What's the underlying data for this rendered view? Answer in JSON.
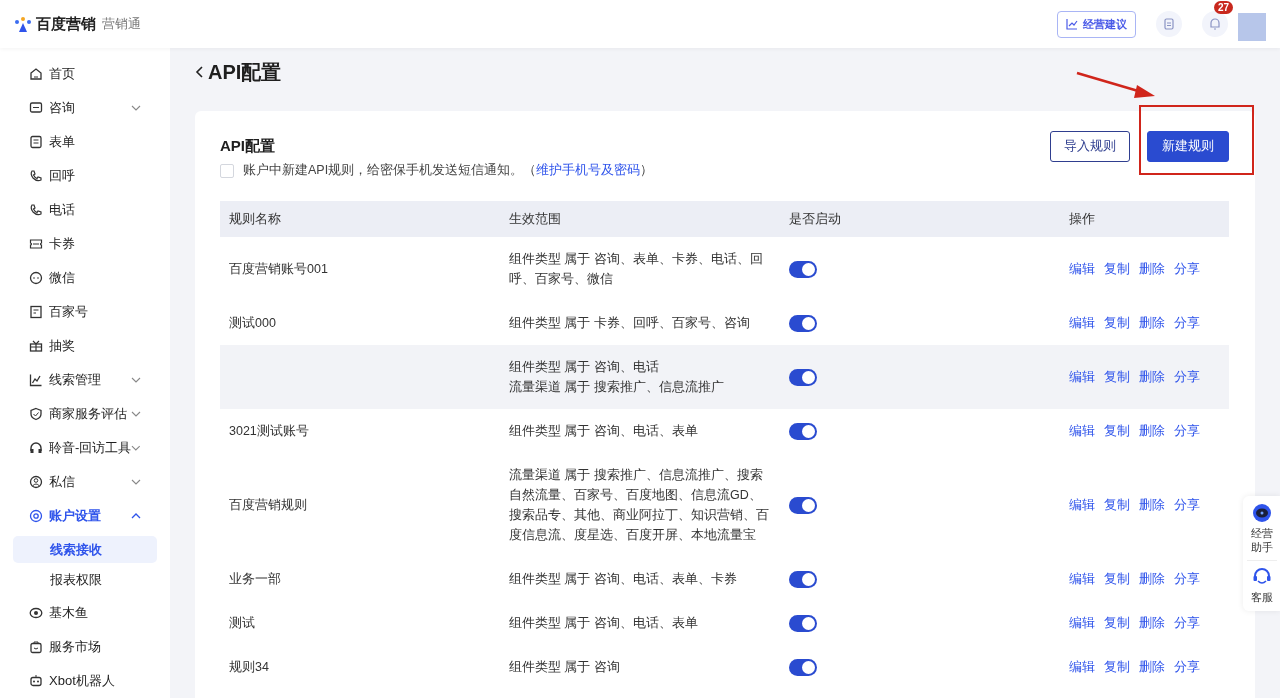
{
  "header": {
    "logo_text": "百度营销",
    "product": "营销通",
    "advice_button": "经营建议",
    "notification_count": "27"
  },
  "sidebar": {
    "items": [
      {
        "label": "首页",
        "selected": false
      },
      {
        "label": "咨询",
        "expanded": false,
        "selected": false
      },
      {
        "label": "表单",
        "selected": false
      },
      {
        "label": "回呼",
        "selected": false
      },
      {
        "label": "电话",
        "selected": false
      },
      {
        "label": "卡券",
        "selected": false
      },
      {
        "label": "微信",
        "selected": false
      },
      {
        "label": "百家号",
        "selected": false
      },
      {
        "label": "抽奖",
        "selected": false
      },
      {
        "label": "线索管理",
        "expanded": false,
        "selected": false
      },
      {
        "label": "商家服务评估",
        "expanded": false,
        "selected": false
      },
      {
        "label": "聆音-回访工具",
        "expanded": false,
        "selected": false
      },
      {
        "label": "私信",
        "expanded": false,
        "selected": false
      },
      {
        "label": "账户设置",
        "expanded": true,
        "selected": true,
        "children": [
          {
            "label": "线索接收",
            "selected": true
          },
          {
            "label": "报表权限",
            "selected": false
          }
        ]
      },
      {
        "label": "基木鱼",
        "selected": false
      },
      {
        "label": "服务市场",
        "selected": false
      },
      {
        "label": "Xbot机器人",
        "selected": false
      }
    ]
  },
  "page_title": "API配置",
  "card": {
    "title": "API配置",
    "import_button": "导入规则",
    "new_button": "新建规则",
    "notify": {
      "checked": false,
      "text": "账户中新建API规则，给密保手机发送短信通知。（",
      "link": "维护手机号及密码",
      "suffix": "）"
    },
    "table": {
      "columns": [
        "规则名称",
        "生效范围",
        "是否启动",
        "操作"
      ],
      "rows": [
        {
          "name": "百度营销账号001",
          "scope": [
            "组件类型 属于 咨询、表单、卡券、电话、回呼、百家号、微信"
          ],
          "on": true,
          "hovered": false,
          "actions": [
            "编辑",
            "复制",
            "删除",
            "分享"
          ]
        },
        {
          "name": "测试000",
          "scope": [
            "组件类型 属于 卡券、回呼、百家号、咨询"
          ],
          "on": true,
          "hovered": false,
          "actions": [
            "编辑",
            "复制",
            "删除",
            "分享"
          ]
        },
        {
          "name": "",
          "scope": [
            "组件类型 属于 咨询、电话",
            "流量渠道 属于 搜索推广、信息流推广"
          ],
          "on": true,
          "hovered": true,
          "actions": [
            "编辑",
            "复制",
            "删除",
            "分享"
          ]
        },
        {
          "name": "3021测试账号",
          "scope": [
            "组件类型 属于 咨询、电话、表单"
          ],
          "on": true,
          "hovered": false,
          "actions": [
            "编辑",
            "复制",
            "删除",
            "分享"
          ]
        },
        {
          "name": "百度营销规则",
          "scope": [
            "流量渠道 属于 搜索推广、信息流推广、搜索自然流量、百家号、百度地图、信息流GD、搜索品专、其他、商业阿拉丁、知识营销、百度信息流、度星选、百度开屏、本地流量宝"
          ],
          "on": true,
          "hovered": false,
          "actions": [
            "编辑",
            "复制",
            "删除",
            "分享"
          ]
        },
        {
          "name": "业务一部",
          "scope": [
            "组件类型 属于 咨询、电话、表单、卡券"
          ],
          "on": true,
          "hovered": false,
          "actions": [
            "编辑",
            "复制",
            "删除",
            "分享"
          ]
        },
        {
          "name": "测试",
          "scope": [
            "组件类型 属于 咨询、电话、表单"
          ],
          "on": true,
          "hovered": false,
          "actions": [
            "编辑",
            "复制",
            "删除",
            "分享"
          ]
        },
        {
          "name": "规则34",
          "scope": [
            "组件类型 属于 咨询"
          ],
          "on": true,
          "hovered": false,
          "actions": [
            "编辑",
            "复制",
            "删除",
            "分享"
          ]
        }
      ]
    }
  },
  "float_panel": {
    "assistant": "经营助手",
    "service": "客服"
  }
}
